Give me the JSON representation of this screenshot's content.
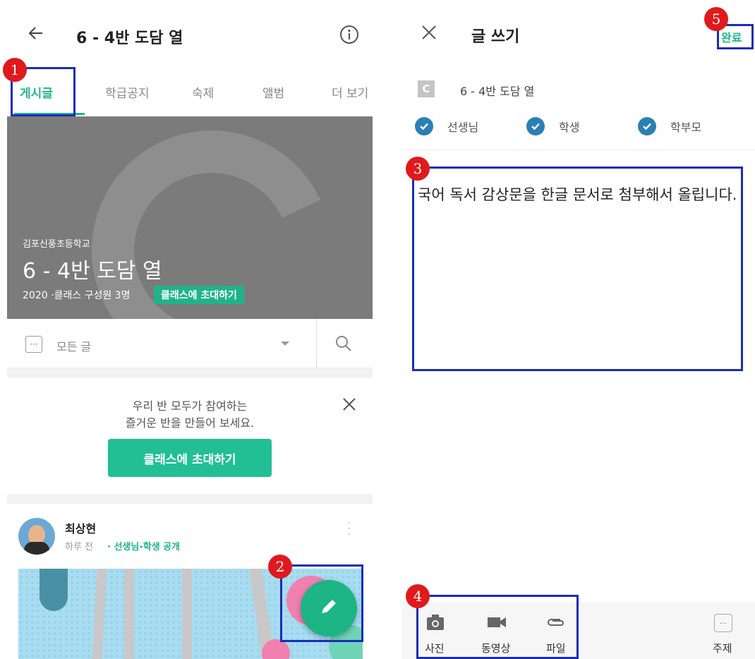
{
  "left": {
    "header": {
      "title": "6 - 4반 도담 열"
    },
    "tabs": [
      {
        "label": "게시글"
      },
      {
        "label": "학급공지"
      },
      {
        "label": "숙제"
      },
      {
        "label": "앨범"
      },
      {
        "label": "더 보기"
      }
    ],
    "banner": {
      "school": "김포신풍초등학교",
      "class_name": "6 - 4반 도담 열",
      "meta": "2020 ·클래스 구성원 3명",
      "invite": "클래스에 초대하기"
    },
    "filter": {
      "label": "모든 글"
    },
    "promo": {
      "line1": "우리 반 모두가 참여하는",
      "line2": "즐거운 반을 만들어 보세요.",
      "button": "클래스에 초대하기"
    },
    "post": {
      "author": "최상현",
      "time": "하루 전",
      "visibility": "· 선생님-학생 공개"
    }
  },
  "right": {
    "header": {
      "title": "글 쓰기",
      "done": "완료"
    },
    "class": {
      "badge": "C",
      "name": "6 - 4반 도담 열"
    },
    "audience": [
      {
        "label": "선생님"
      },
      {
        "label": "학생"
      },
      {
        "label": "학부모"
      }
    ],
    "content": {
      "text": "국어 독서 감상문을 한글 문서로 첨부해서 올립니다."
    },
    "toolbar": [
      {
        "label": "사진",
        "icon": "camera-icon"
      },
      {
        "label": "동영상",
        "icon": "video-icon"
      },
      {
        "label": "파일",
        "icon": "paperclip-icon"
      },
      {
        "label": "주제",
        "icon": "more-icon"
      }
    ]
  },
  "annotations": [
    "1",
    "2",
    "3",
    "4",
    "5"
  ],
  "colors": {
    "accent": "#20b38a",
    "highlight": "#1a2db5",
    "marker": "#e0191d",
    "check": "#2b7fb3"
  }
}
